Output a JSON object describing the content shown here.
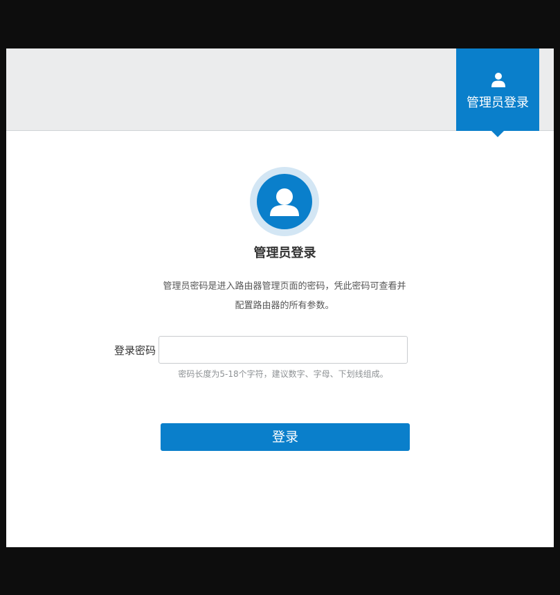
{
  "header": {
    "admin_tab": {
      "icon": "user-icon",
      "label": "管理员登录"
    }
  },
  "login": {
    "avatar_icon": "user-avatar-icon",
    "title": "管理员登录",
    "description": "管理员密码是进入路由器管理页面的密码，凭此密码可查看并配置路由器的所有参数。",
    "password_label": "登录密码",
    "password_value": "",
    "password_hint": "密码长度为5-18个字符，建议数字、字母、下划线组成。",
    "submit_label": "登录"
  },
  "colors": {
    "accent": "#0a7fcb",
    "header_bg": "#ebeced",
    "avatar_ring": "#d3e6f4"
  }
}
